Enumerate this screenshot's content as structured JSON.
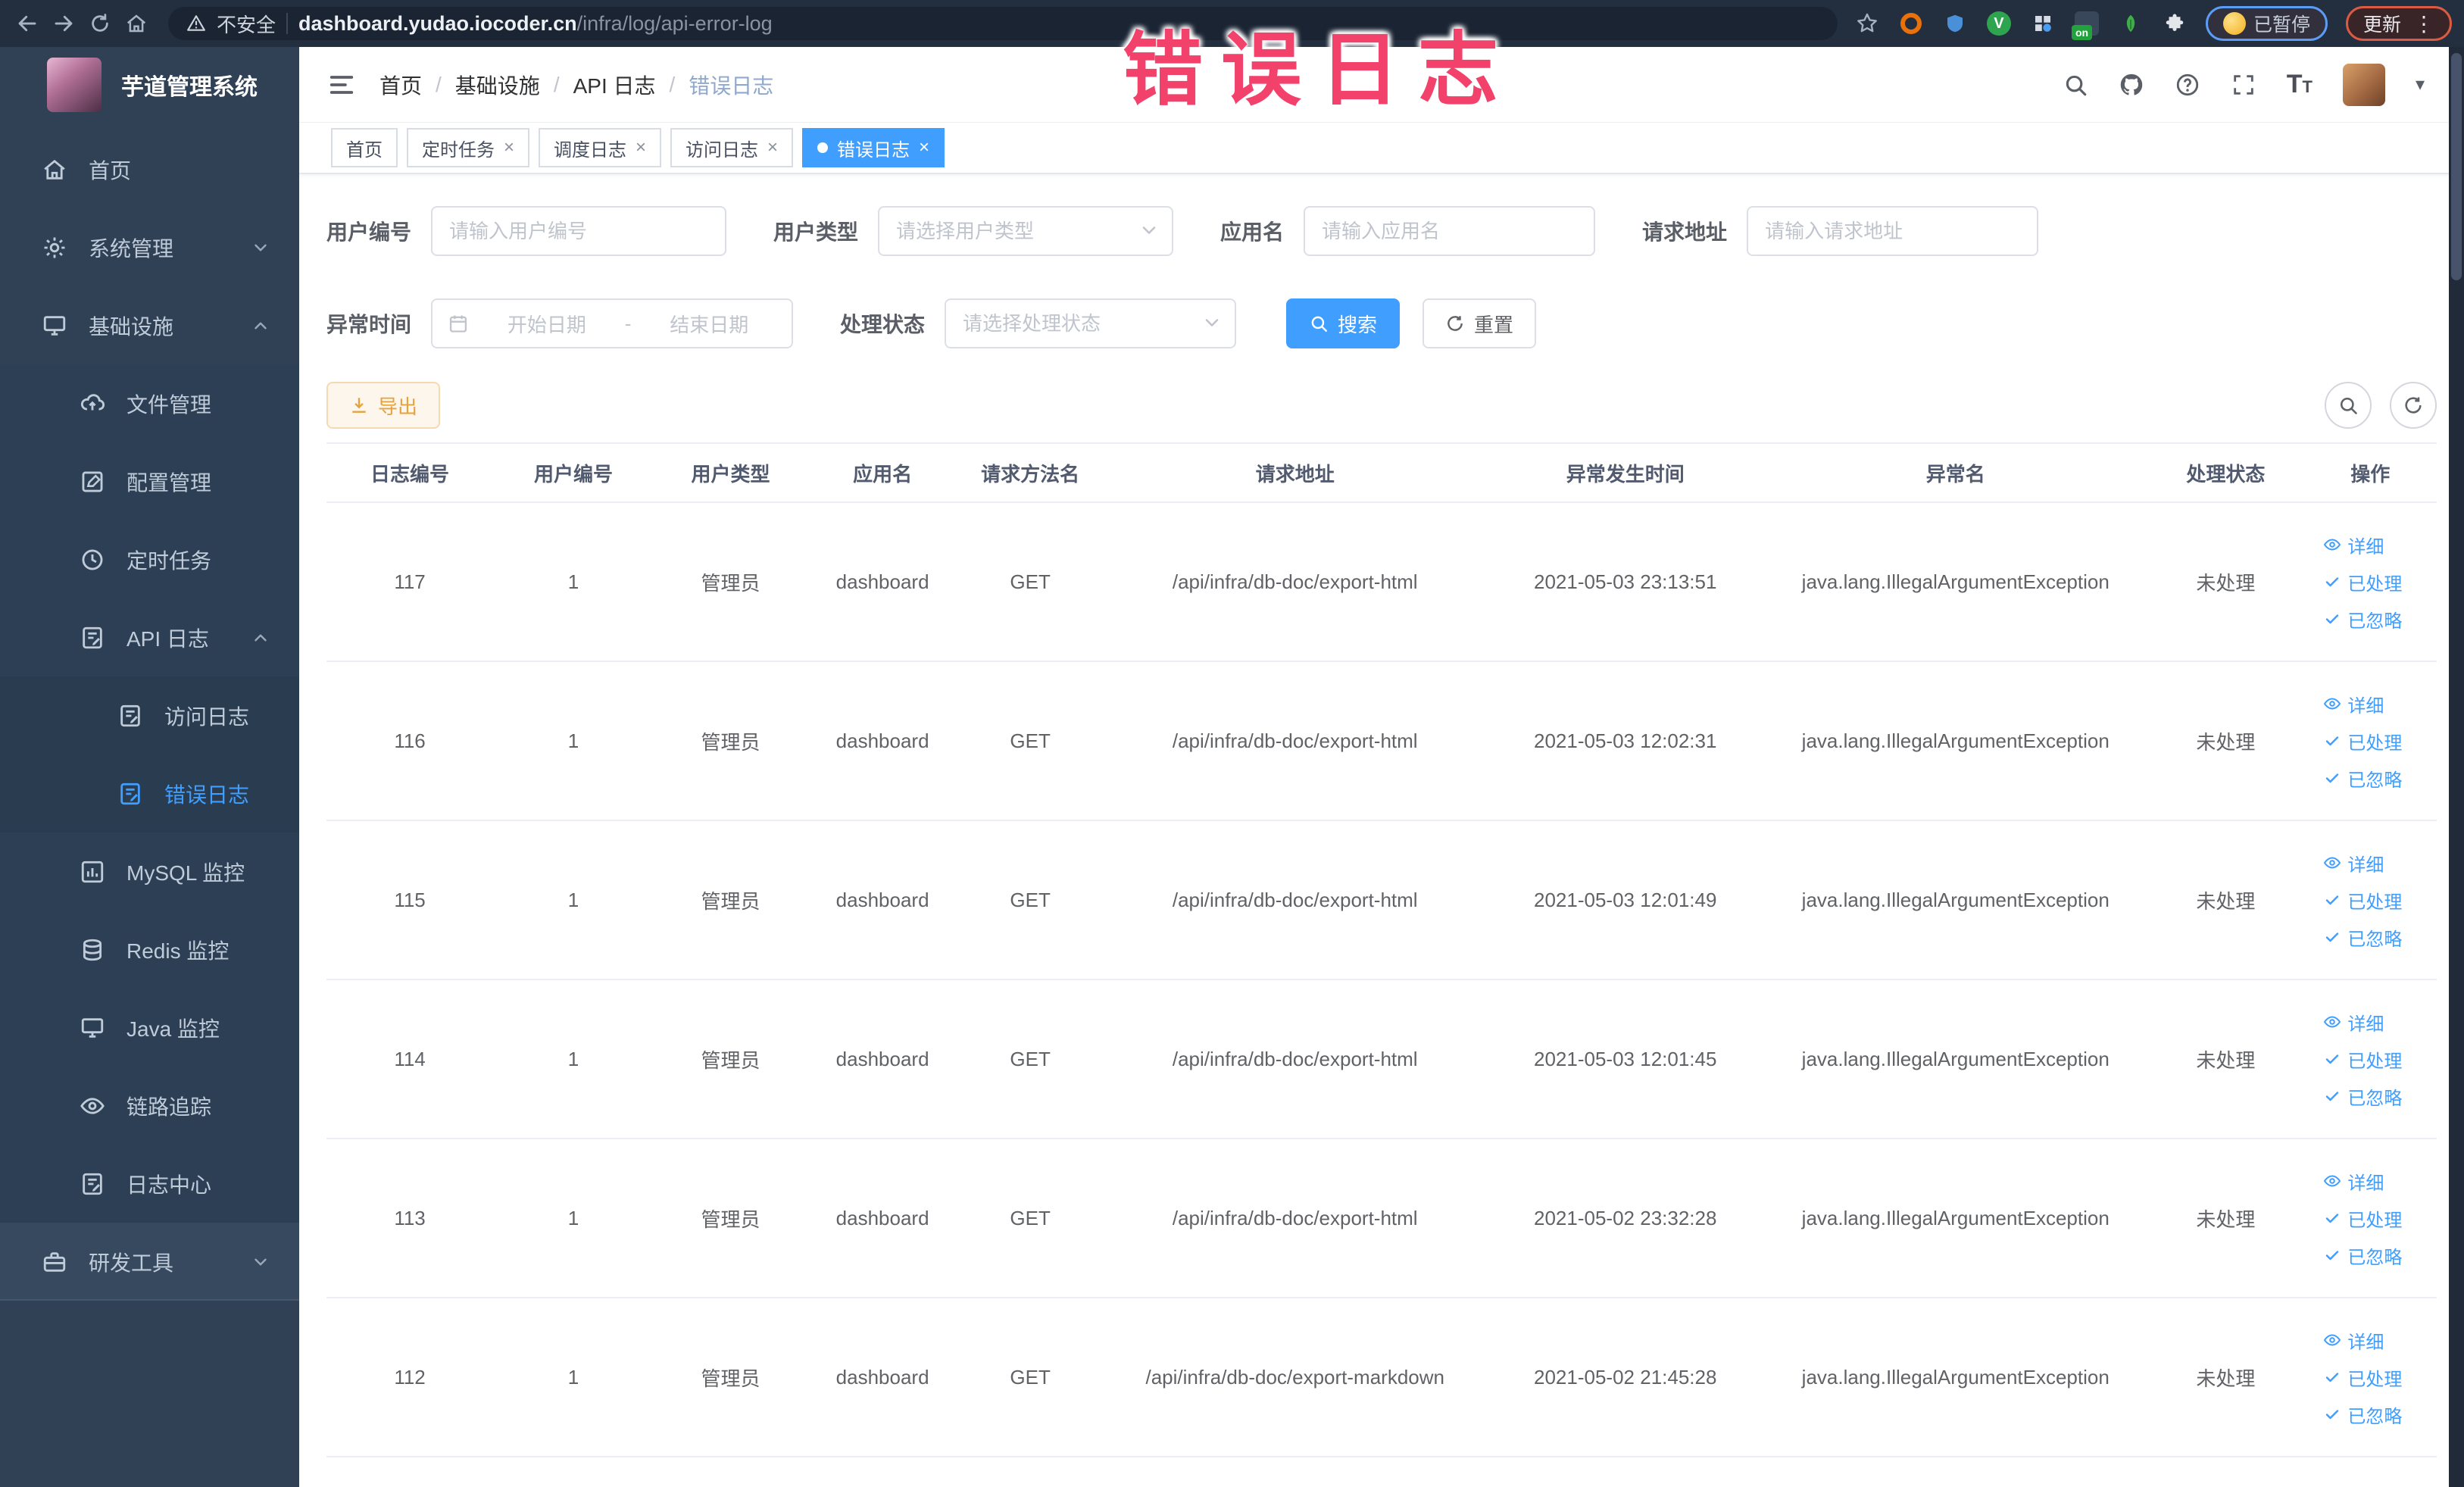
{
  "annotation": {
    "title": "错误日志"
  },
  "glyphs": {
    "close": "×",
    "caret": "▾",
    "kebab": "⋮",
    "range_separator": "-",
    "on_badge": "on",
    "ext_v": "V"
  },
  "colors": {
    "primary": "#409EFF",
    "warning": "#e6a23c",
    "sidebar_bg": "#304156",
    "annotation_pink": "#f2416b",
    "chrome_bg": "#232e3e"
  },
  "browser": {
    "security_label": "不安全",
    "url_host": "dashboard.yudao.iocoder.cn",
    "url_path": "/infra/log/api-error-log",
    "paused_badge_label": "已暂停",
    "update_button_label": "更新"
  },
  "sidebar": {
    "logo_title": "芋道管理系统",
    "items": [
      {
        "label": "首页"
      },
      {
        "label": "系统管理"
      },
      {
        "label": "基础设施"
      },
      {
        "label": "文件管理"
      },
      {
        "label": "配置管理"
      },
      {
        "label": "定时任务"
      },
      {
        "label": "API 日志"
      },
      {
        "label": "访问日志"
      },
      {
        "label": "错误日志"
      },
      {
        "label": "MySQL 监控"
      },
      {
        "label": "Redis 监控"
      },
      {
        "label": "Java 监控"
      },
      {
        "label": "链路追踪"
      },
      {
        "label": "日志中心"
      },
      {
        "label": "研发工具"
      }
    ]
  },
  "breadcrumb": [
    "首页",
    "基础设施",
    "API 日志",
    "错误日志"
  ],
  "tabs": [
    {
      "label": "首页"
    },
    {
      "label": "定时任务"
    },
    {
      "label": "调度日志"
    },
    {
      "label": "访问日志"
    },
    {
      "label": "错误日志"
    }
  ],
  "filters": {
    "user_id": {
      "label": "用户编号",
      "placeholder": "请输入用户编号"
    },
    "user_type": {
      "label": "用户类型",
      "placeholder": "请选择用户类型"
    },
    "app_name": {
      "label": "应用名",
      "placeholder": "请输入应用名"
    },
    "request_url": {
      "label": "请求地址",
      "placeholder": "请输入请求地址"
    },
    "exception_time": {
      "label": "异常时间",
      "start_placeholder": "开始日期",
      "end_placeholder": "结束日期"
    },
    "process_status": {
      "label": "处理状态",
      "placeholder": "请选择处理状态"
    },
    "search_label": "搜索",
    "reset_label": "重置"
  },
  "toolbar": {
    "export_label": "导出"
  },
  "table": {
    "headers": [
      "日志编号",
      "用户编号",
      "用户类型",
      "应用名",
      "请求方法名",
      "请求地址",
      "异常发生时间",
      "异常名",
      "处理状态",
      "操作"
    ],
    "action_labels": [
      "详细",
      "已处理",
      "已忽略"
    ],
    "rows": [
      {
        "id": "117",
        "user_id": "1",
        "user_type": "管理员",
        "app": "dashboard",
        "method": "GET",
        "url": "/api/infra/db-doc/export-html",
        "time": "2021-05-03 23:13:51",
        "exception": "java.lang.IllegalArgumentException",
        "status": "未处理"
      },
      {
        "id": "116",
        "user_id": "1",
        "user_type": "管理员",
        "app": "dashboard",
        "method": "GET",
        "url": "/api/infra/db-doc/export-html",
        "time": "2021-05-03 12:02:31",
        "exception": "java.lang.IllegalArgumentException",
        "status": "未处理"
      },
      {
        "id": "115",
        "user_id": "1",
        "user_type": "管理员",
        "app": "dashboard",
        "method": "GET",
        "url": "/api/infra/db-doc/export-html",
        "time": "2021-05-03 12:01:49",
        "exception": "java.lang.IllegalArgumentException",
        "status": "未处理"
      },
      {
        "id": "114",
        "user_id": "1",
        "user_type": "管理员",
        "app": "dashboard",
        "method": "GET",
        "url": "/api/infra/db-doc/export-html",
        "time": "2021-05-03 12:01:45",
        "exception": "java.lang.IllegalArgumentException",
        "status": "未处理"
      },
      {
        "id": "113",
        "user_id": "1",
        "user_type": "管理员",
        "app": "dashboard",
        "method": "GET",
        "url": "/api/infra/db-doc/export-html",
        "time": "2021-05-02 23:32:28",
        "exception": "java.lang.IllegalArgumentException",
        "status": "未处理"
      },
      {
        "id": "112",
        "user_id": "1",
        "user_type": "管理员",
        "app": "dashboard",
        "method": "GET",
        "url": "/api/infra/db-doc/export-markdown",
        "time": "2021-05-02 21:45:28",
        "exception": "java.lang.IllegalArgumentException",
        "status": "未处理"
      }
    ]
  }
}
